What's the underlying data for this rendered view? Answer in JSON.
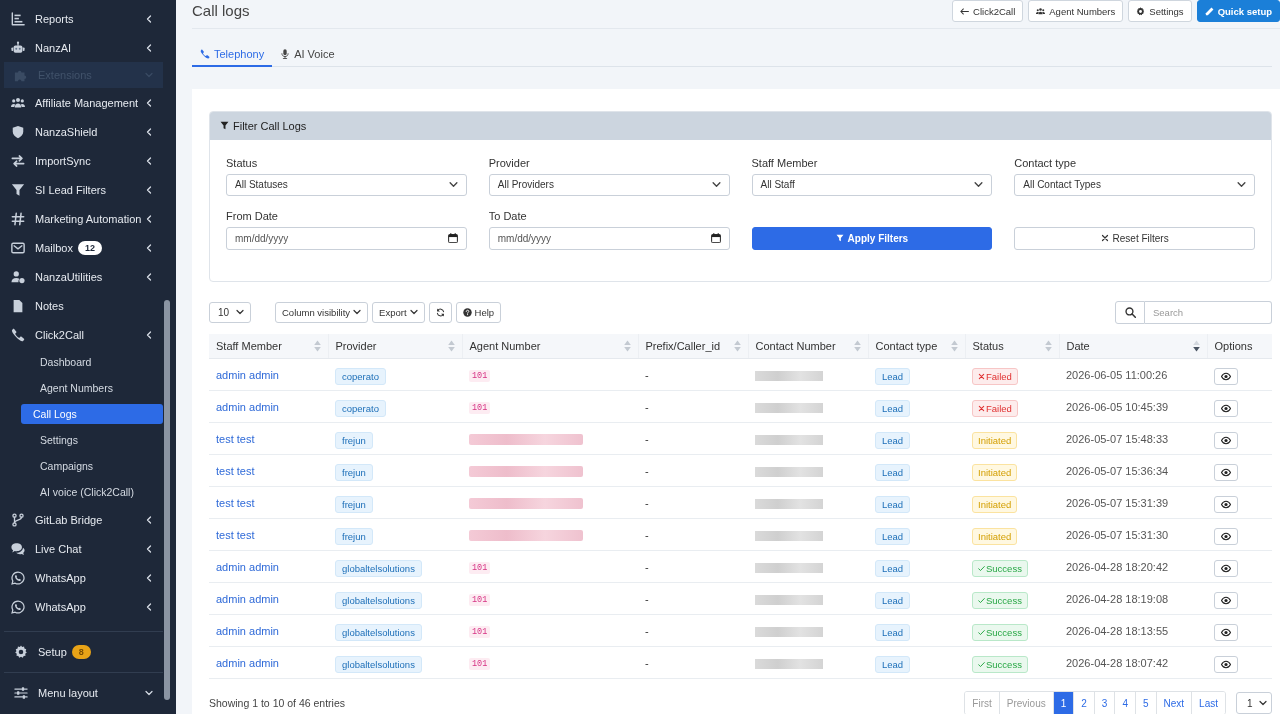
{
  "sidebar": {
    "items": [
      {
        "label": "Reports",
        "kind": "menu"
      },
      {
        "label": "NanzAI",
        "kind": "menu"
      },
      {
        "label": "Extensions",
        "kind": "section"
      },
      {
        "label": "Affiliate Management",
        "kind": "menu"
      },
      {
        "label": "NanzaShield",
        "kind": "menu"
      },
      {
        "label": "ImportSync",
        "kind": "menu"
      },
      {
        "label": "SI Lead Filters",
        "kind": "menu"
      },
      {
        "label": "Marketing Automation",
        "kind": "menu"
      },
      {
        "label": "Mailbox",
        "kind": "menu",
        "badge": {
          "text": "12",
          "kind": "count"
        }
      },
      {
        "label": "NanzaUtilities",
        "kind": "menu"
      },
      {
        "label": "Notes",
        "kind": "link"
      },
      {
        "label": "Click2Call",
        "kind": "menu",
        "children": [
          {
            "label": "Dashboard",
            "selected": false
          },
          {
            "label": "Agent Numbers",
            "selected": false
          },
          {
            "label": "Call Logs",
            "selected": true
          },
          {
            "label": "Settings",
            "selected": false
          },
          {
            "label": "Campaigns",
            "selected": false
          },
          {
            "label": "AI voice (Click2Call)",
            "selected": false
          }
        ]
      },
      {
        "label": "GitLab Bridge",
        "kind": "menu"
      },
      {
        "label": "Live Chat",
        "kind": "menu"
      },
      {
        "label": "WhatsApp",
        "kind": "menu"
      },
      {
        "label": "WhatsApp",
        "kind": "menu"
      }
    ],
    "footer": [
      {
        "label": "Setup",
        "kind": "link",
        "badge": {
          "text": "8",
          "kind": "warning"
        }
      },
      {
        "label": "Menu layout",
        "kind": "dropdown"
      }
    ]
  },
  "header": {
    "title": "Call logs",
    "buttons": [
      {
        "label": "Click2Call",
        "kind": "back"
      },
      {
        "label": "Agent Numbers",
        "kind": "default"
      },
      {
        "label": "Settings",
        "kind": "default"
      },
      {
        "label": "Quick setup",
        "kind": "primary"
      }
    ]
  },
  "tabs": [
    {
      "label": "Telephony",
      "selected": true
    },
    {
      "label": "AI Voice",
      "selected": false
    }
  ],
  "filter": {
    "title": "Filter Call Logs",
    "fields": [
      {
        "label": "Status",
        "kind": "select",
        "value": "All Statuses"
      },
      {
        "label": "Provider",
        "kind": "select",
        "value": "All Providers"
      },
      {
        "label": "Staff Member",
        "kind": "select",
        "value": "All Staff"
      },
      {
        "label": "Contact type",
        "kind": "select",
        "value": "All Contact Types"
      },
      {
        "label": "From Date",
        "kind": "date",
        "placeholder": "mm/dd/yyyy"
      },
      {
        "label": "To Date",
        "kind": "date",
        "placeholder": "mm/dd/yyyy"
      }
    ],
    "buttons": [
      {
        "label": "Apply Filters",
        "kind": "primary"
      },
      {
        "label": "Reset Filters",
        "kind": "secondary"
      }
    ]
  },
  "table": {
    "page_length": "10",
    "toolbar_buttons": [
      {
        "label": "Column visibility",
        "kind": "dropdown"
      },
      {
        "label": "Export",
        "kind": "dropdown"
      },
      {
        "kind": "refresh"
      },
      {
        "label": "Help",
        "kind": "help"
      }
    ],
    "search_placeholder": "Search",
    "columns": [
      {
        "label": "Staff Member",
        "sortable": true,
        "sorted_descending": false
      },
      {
        "label": "Provider",
        "sortable": true,
        "sorted_descending": false
      },
      {
        "label": "Agent Number",
        "sortable": true,
        "sorted_descending": false
      },
      {
        "label": "Prefix/Caller_id",
        "sortable": true,
        "sorted_descending": false
      },
      {
        "label": "Contact Number",
        "sortable": true,
        "sorted_descending": false
      },
      {
        "label": "Contact type",
        "sortable": true,
        "sorted_descending": false
      },
      {
        "label": "Status",
        "sortable": true,
        "sorted_descending": false
      },
      {
        "label": "Date",
        "sortable": true,
        "sorted_descending": true
      },
      {
        "label": "Options",
        "sortable": false,
        "sorted_descending": false
      }
    ],
    "rows": [
      {
        "staff": "admin admin",
        "provider": "coperato",
        "agent_number": {
          "kind": "code",
          "text": "101"
        },
        "prefix": "-",
        "contact_number": {
          "kind": "redacted"
        },
        "contact_type": "Lead",
        "status": {
          "kind": "failed",
          "label": "Failed"
        },
        "date": "2026-06-05 11:00:26"
      },
      {
        "staff": "admin admin",
        "provider": "coperato",
        "agent_number": {
          "kind": "code",
          "text": "101"
        },
        "prefix": "-",
        "contact_number": {
          "kind": "redacted"
        },
        "contact_type": "Lead",
        "status": {
          "kind": "failed",
          "label": "Failed"
        },
        "date": "2026-06-05 10:45:39"
      },
      {
        "staff": "test test",
        "provider": "frejun",
        "agent_number": {
          "kind": "redacted"
        },
        "prefix": "-",
        "contact_number": {
          "kind": "redacted"
        },
        "contact_type": "Lead",
        "status": {
          "kind": "initiated",
          "label": "Initiated"
        },
        "date": "2026-05-07 15:48:33"
      },
      {
        "staff": "test test",
        "provider": "frejun",
        "agent_number": {
          "kind": "redacted"
        },
        "prefix": "-",
        "contact_number": {
          "kind": "redacted"
        },
        "contact_type": "Lead",
        "status": {
          "kind": "initiated",
          "label": "Initiated"
        },
        "date": "2026-05-07 15:36:34"
      },
      {
        "staff": "test test",
        "provider": "frejun",
        "agent_number": {
          "kind": "redacted"
        },
        "prefix": "-",
        "contact_number": {
          "kind": "redacted"
        },
        "contact_type": "Lead",
        "status": {
          "kind": "initiated",
          "label": "Initiated"
        },
        "date": "2026-05-07 15:31:39"
      },
      {
        "staff": "test test",
        "provider": "frejun",
        "agent_number": {
          "kind": "redacted"
        },
        "prefix": "-",
        "contact_number": {
          "kind": "redacted"
        },
        "contact_type": "Lead",
        "status": {
          "kind": "initiated",
          "label": "Initiated"
        },
        "date": "2026-05-07 15:31:30"
      },
      {
        "staff": "admin admin",
        "provider": "globaltelsolutions",
        "agent_number": {
          "kind": "code",
          "text": "101"
        },
        "prefix": "-",
        "contact_number": {
          "kind": "redacted"
        },
        "contact_type": "Lead",
        "status": {
          "kind": "success",
          "label": "Success"
        },
        "date": "2026-04-28 18:20:42"
      },
      {
        "staff": "admin admin",
        "provider": "globaltelsolutions",
        "agent_number": {
          "kind": "code",
          "text": "101"
        },
        "prefix": "-",
        "contact_number": {
          "kind": "redacted"
        },
        "contact_type": "Lead",
        "status": {
          "kind": "success",
          "label": "Success"
        },
        "date": "2026-04-28 18:19:08"
      },
      {
        "staff": "admin admin",
        "provider": "globaltelsolutions",
        "agent_number": {
          "kind": "code",
          "text": "101"
        },
        "prefix": "-",
        "contact_number": {
          "kind": "redacted"
        },
        "contact_type": "Lead",
        "status": {
          "kind": "success",
          "label": "Success"
        },
        "date": "2026-04-28 18:13:55"
      },
      {
        "staff": "admin admin",
        "provider": "globaltelsolutions",
        "agent_number": {
          "kind": "code",
          "text": "101"
        },
        "prefix": "-",
        "contact_number": {
          "kind": "redacted"
        },
        "contact_type": "Lead",
        "status": {
          "kind": "success",
          "label": "Success"
        },
        "date": "2026-04-28 18:07:42"
      }
    ],
    "info": "Showing 1 to 10 of 46 entries",
    "pagination": [
      {
        "label": "First",
        "selected": false,
        "disabled": true
      },
      {
        "label": "Previous",
        "selected": false,
        "disabled": true
      },
      {
        "label": "1",
        "selected": true,
        "disabled": false
      },
      {
        "label": "2",
        "selected": false,
        "disabled": false
      },
      {
        "label": "3",
        "selected": false,
        "disabled": false
      },
      {
        "label": "4",
        "selected": false,
        "disabled": false
      },
      {
        "label": "5",
        "selected": false,
        "disabled": false
      },
      {
        "label": "Next",
        "selected": false,
        "disabled": false
      },
      {
        "label": "Last",
        "selected": false,
        "disabled": false
      }
    ],
    "page_select": "1"
  }
}
